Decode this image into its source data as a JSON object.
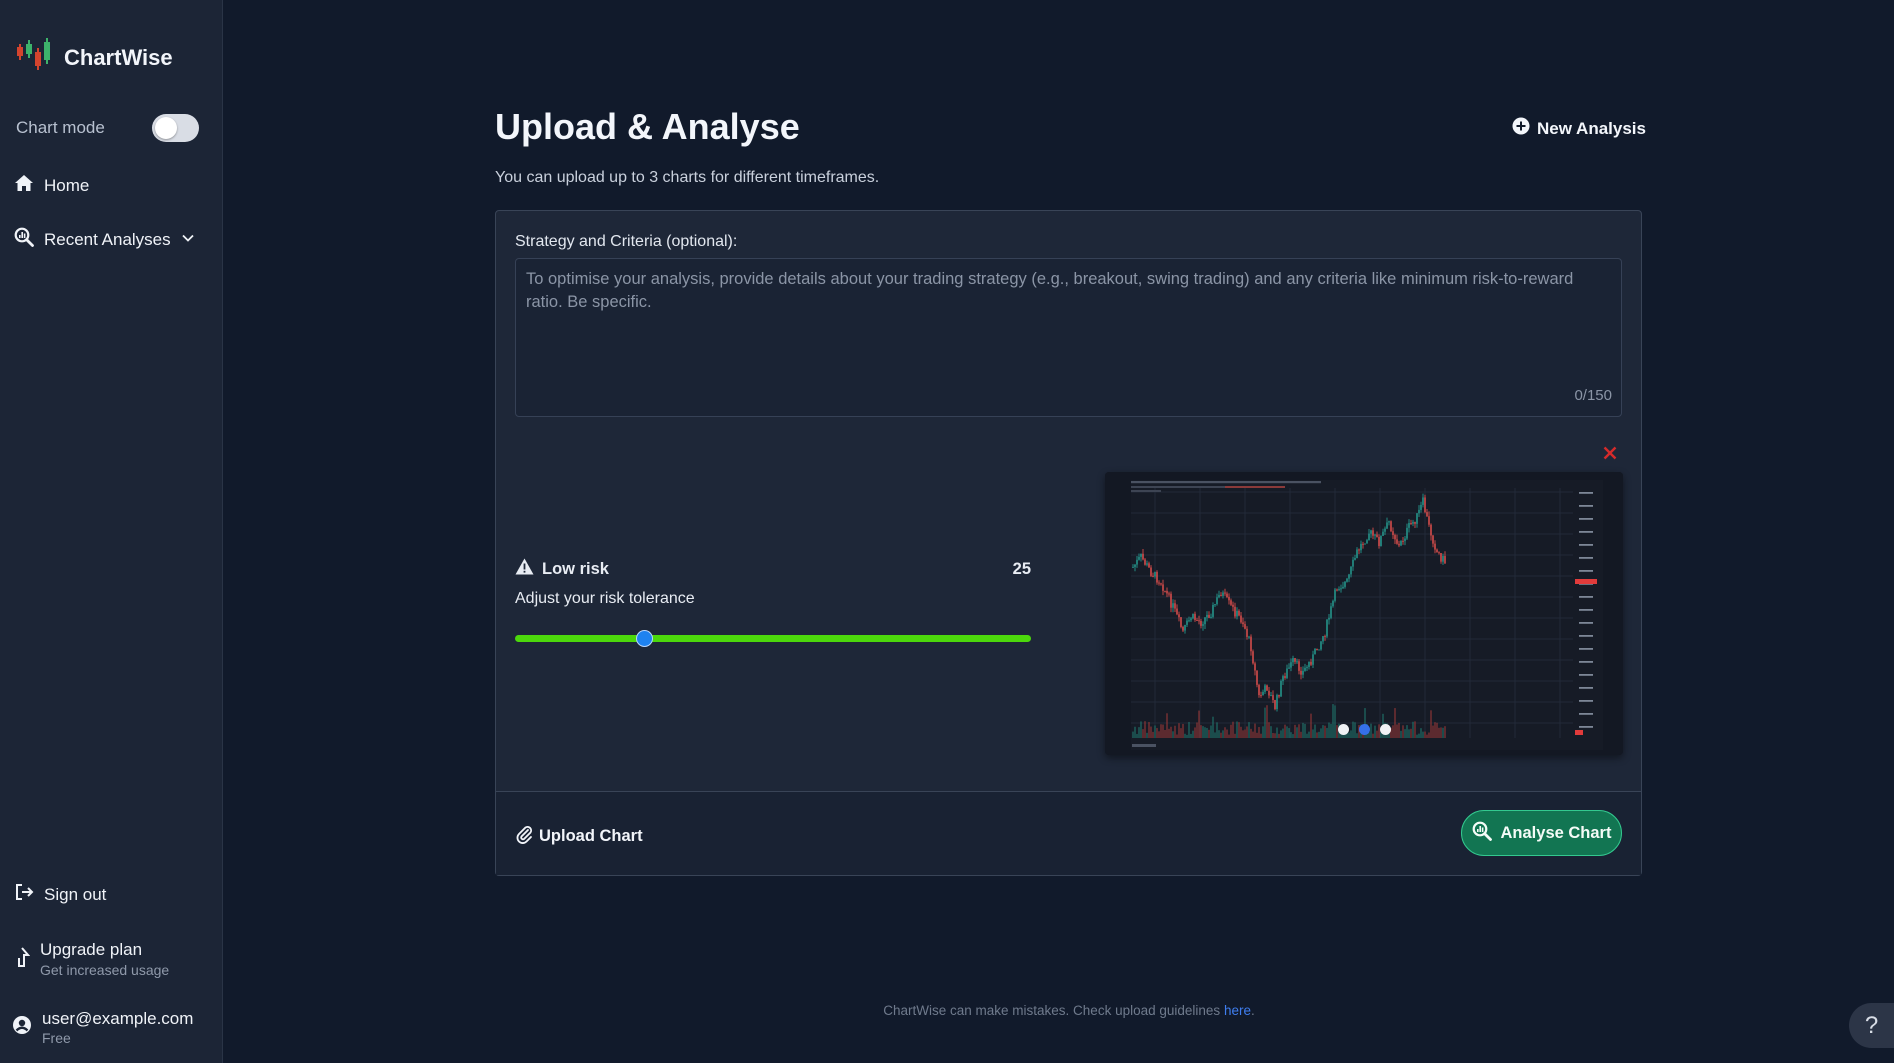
{
  "app": {
    "name": "ChartWise"
  },
  "sidebar": {
    "chart_mode_label": "Chart mode",
    "chart_mode_on": false,
    "nav": {
      "home": "Home",
      "recent": "Recent Analyses",
      "sign_out": "Sign out"
    },
    "upgrade": {
      "title": "Upgrade plan",
      "subtitle": "Get increased usage"
    },
    "user": {
      "email": "user@example.com",
      "plan": "Free"
    }
  },
  "main": {
    "title": "Upload & Analyse",
    "new_analysis": "New Analysis",
    "subtitle": "You can upload up to 3 charts for different timeframes."
  },
  "strategy": {
    "label": "Strategy and Criteria (optional):",
    "placeholder": "To optimise your analysis, provide details about your trading strategy (e.g., breakout, swing trading) and any criteria like minimum risk-to-reward ratio. Be specific.",
    "value": "",
    "count": "0/150"
  },
  "risk": {
    "label": "Low risk",
    "value": "25",
    "description": "Adjust your risk tolerance",
    "fraction": 0.25
  },
  "carousel": {
    "count": 3,
    "active": 1
  },
  "actions": {
    "upload": "Upload Chart",
    "analyse": "Analyse Chart"
  },
  "footer": {
    "text": "ChartWise can make mistakes. Check upload guidelines",
    "link": "here",
    "end": "."
  },
  "help_label": "?",
  "colors": {
    "background": "#111a2b",
    "sidebar": "#1c2536",
    "accent_green": "#4cd80c",
    "analyse_button": "#127552",
    "slider_thumb": "#1e82f0",
    "remove_red": "#d52b2b",
    "link_blue": "#3f7ef0"
  },
  "icons": {
    "logo": "candlestick-logo-icon",
    "home": "home-icon",
    "recent": "magnify-chart-icon",
    "chevron": "chevron-down-icon",
    "sign_out": "sign-out-icon",
    "upgrade": "arrow-up-icon",
    "user": "user-circle-icon",
    "new_analysis": "plus-circle-icon",
    "warning": "warning-triangle-icon",
    "close": "close-icon",
    "upload": "paperclip-icon",
    "analyse": "magnify-chart-icon",
    "help": "question-icon"
  }
}
